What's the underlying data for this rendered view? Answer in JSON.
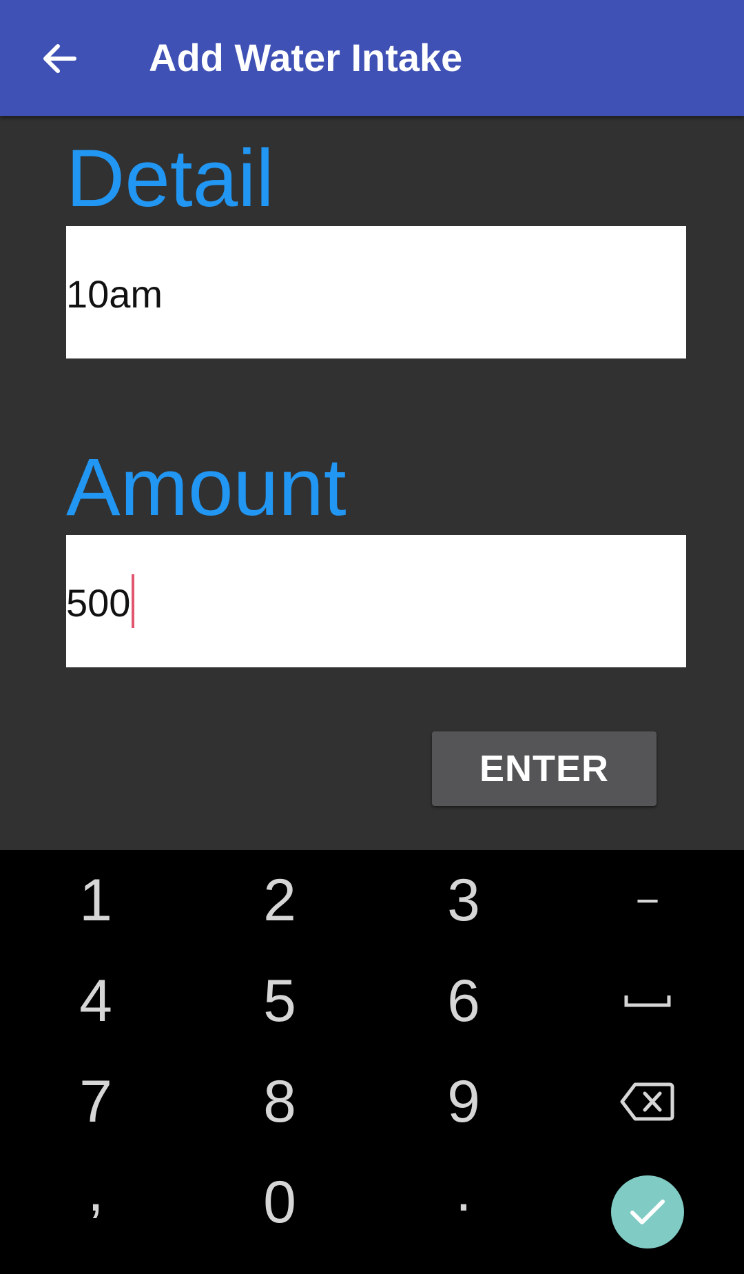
{
  "app_bar": {
    "title": "Add Water Intake",
    "back_icon": "arrow-back-icon",
    "color": "#3f51b5"
  },
  "form": {
    "detail_label": "Detail",
    "detail_value": "10am",
    "amount_label": "Amount",
    "amount_value": "500",
    "enter_label": "ENTER",
    "accent_color": "#2196f3"
  },
  "keyboard": {
    "rows": [
      [
        "1",
        "2",
        "3",
        "−"
      ],
      [
        "4",
        "5",
        "6",
        "space-icon"
      ],
      [
        "7",
        "8",
        "9",
        "backspace-icon"
      ],
      [
        ",",
        "0",
        ".",
        "done-check-icon"
      ]
    ],
    "done_color": "#80cbc4"
  }
}
